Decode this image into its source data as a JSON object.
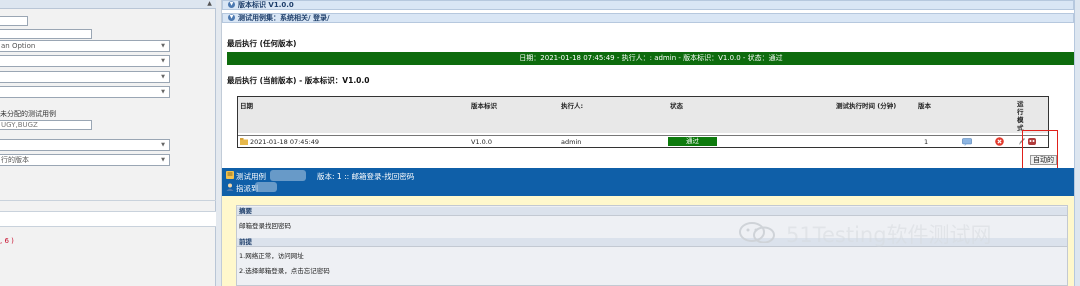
{
  "left_panel": {
    "option_text": "an Option",
    "unassigned_label": "未分配的测试用例",
    "keywords_value": "UGY,BUGZ",
    "version_select": "行的版本",
    "footer_text": ", 6 )"
  },
  "right_panel": {
    "breadcrumb_version": "版本标识 V1.0.0",
    "breadcrumb_suite": "测试用例集：系统相关/ 登录/",
    "last_exec_any_title": "最后执行 (任何版本)",
    "banner_text": "日期：2021-01-18 07:45:49 - 执行人：: admin - 版本标识：V1.0.0 - 状态：通过",
    "last_exec_current_title": "最后执行 (当前版本) - 版本标识：V1.0.0",
    "table": {
      "headers": {
        "date": "日期",
        "build": "版本标识",
        "tester": "执行人:",
        "status": "状态",
        "duration": "测试执行时间 (分钟)",
        "version": "版本",
        "run_mode": "运行模式"
      },
      "row": {
        "date": "2021-01-18 07:45:49",
        "build": "V1.0.0",
        "tester": "admin",
        "status": "通过",
        "version": "1"
      }
    },
    "auto_label": "自动的",
    "testcase_line": "测试用例",
    "testcase_version_title": "版本: 1 :: 邮箱登录-找回密码",
    "assigned_to_label": "指派到",
    "summary_header": "摘要",
    "summary_text": "邮箱登录找回密码",
    "preconditions_header": "前提",
    "precondition_1": "1.网络正常，访问网址",
    "precondition_2": "2.选择邮箱登录，点击忘记密码"
  },
  "watermark": "51Testing软件测试网",
  "colors": {
    "green_banner": "#0d6b0d",
    "blue_bar": "#0f5fa8",
    "highlight": "#e0211b",
    "status_pass": "#0d7a0d"
  }
}
